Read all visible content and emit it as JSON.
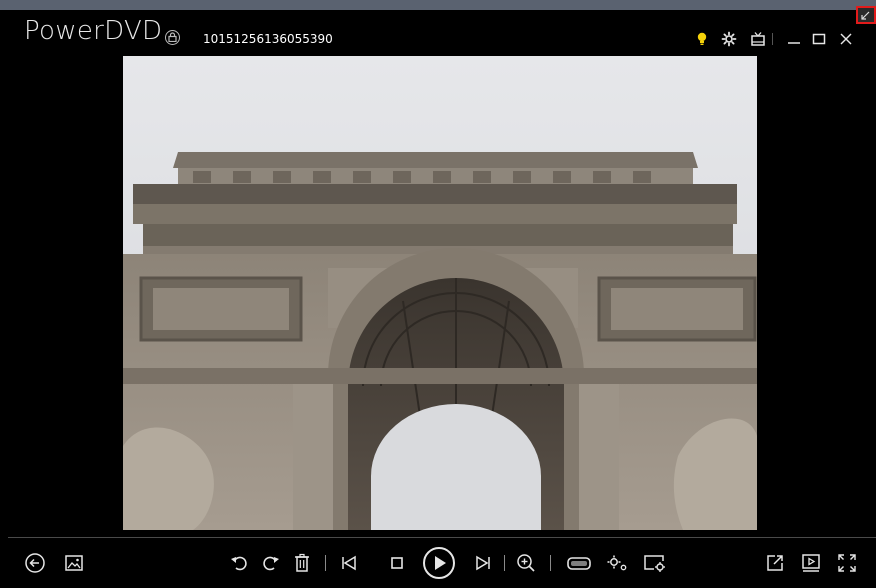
{
  "app": {
    "brand": "PowerDVD",
    "file_name": "10151256136055390"
  },
  "colors": {
    "accent_bulb": "#f5d20a",
    "highlight_frame": "#e21b1b",
    "icon": "#e6e6e6",
    "background": "#000000"
  },
  "titlebar_icons": [
    "lock-icon",
    "lightbulb-icon",
    "settings-gear-icon",
    "tv-mode-icon",
    "minimize-icon",
    "maximize-icon",
    "close-icon",
    "resize-corner-icon"
  ],
  "controls": {
    "left": [
      "back-arrow-icon",
      "photo-library-icon"
    ],
    "center": [
      "rotate-left-icon",
      "rotate-right-icon",
      "delete-trash-icon",
      "previous-icon",
      "stop-icon",
      "play-icon",
      "next-icon",
      "zoom-in-icon",
      "vr-headset-icon",
      "effects-settings-icon",
      "slideshow-settings-icon"
    ],
    "right": [
      "external-open-icon",
      "playlist-icon",
      "fullscreen-icon"
    ]
  }
}
